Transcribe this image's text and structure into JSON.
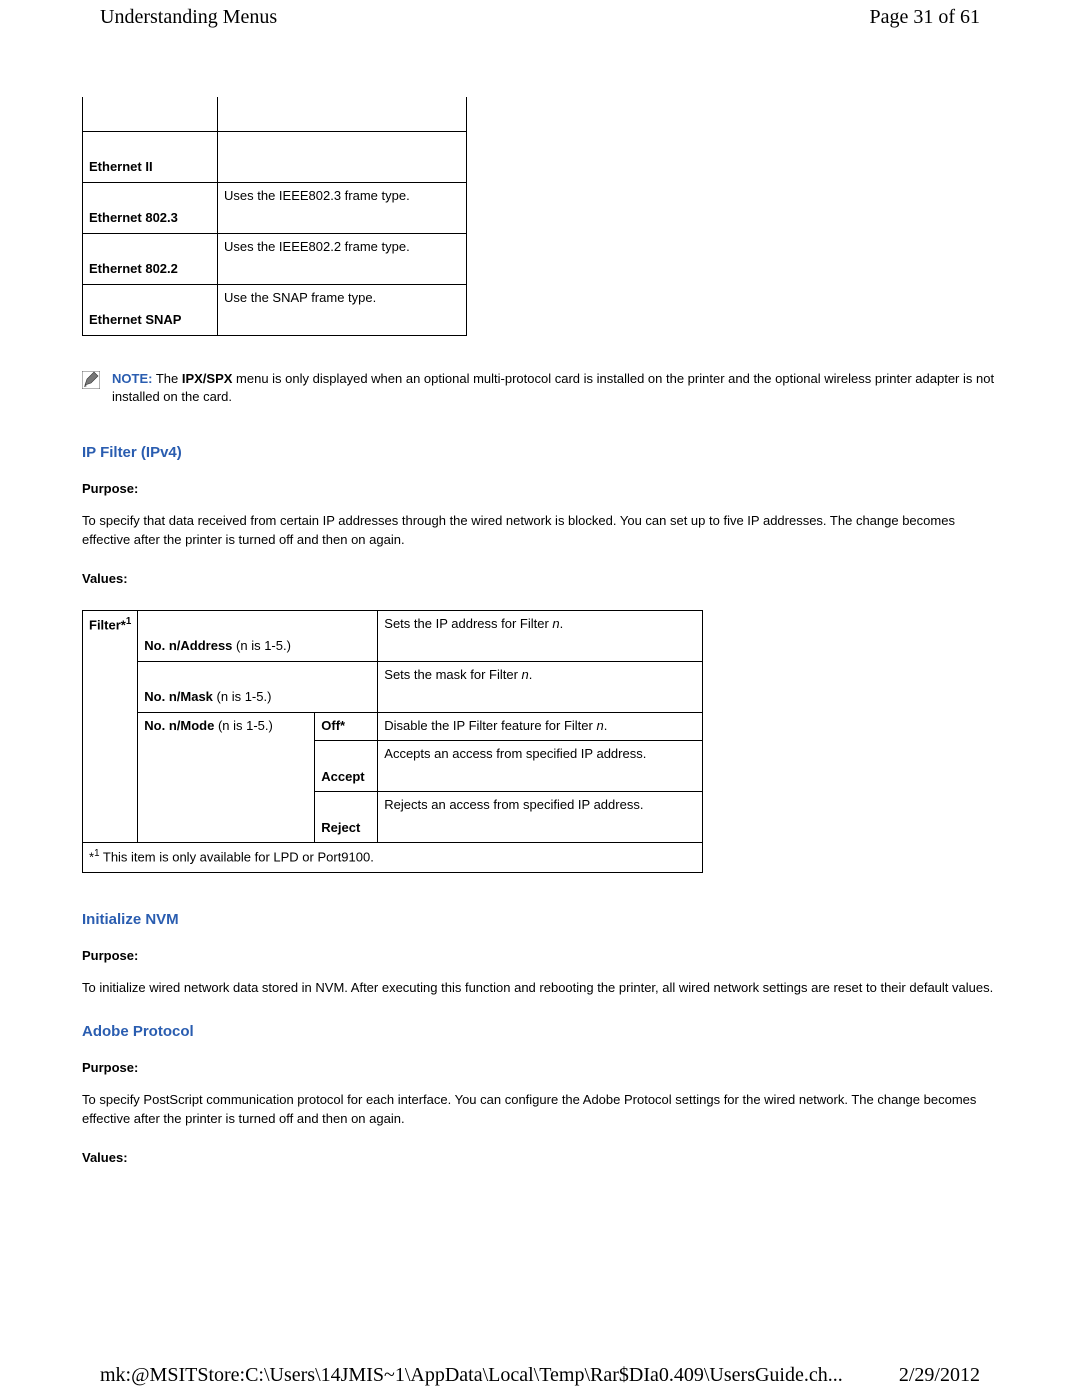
{
  "header": {
    "title": "Understanding Menus",
    "page_label": "Page 31 of 61"
  },
  "frame_table": {
    "rows": [
      {
        "label": "Ethernet II",
        "desc": ""
      },
      {
        "label": "Ethernet 802.3",
        "desc": "Uses the IEEE802.3 frame type."
      },
      {
        "label": "Ethernet 802.2",
        "desc": "Uses the IEEE802.2 frame type."
      },
      {
        "label": "Ethernet SNAP",
        "desc": "Use the SNAP frame type."
      }
    ]
  },
  "note": {
    "label": "NOTE:",
    "text_before_bold": " The ",
    "bold_term": "IPX/SPX",
    "text_after_bold": " menu is only displayed when an optional multi-protocol card is installed on the printer and the optional wireless printer adapter is not installed on the card."
  },
  "ip_filter": {
    "heading": "IP Filter (IPv4)",
    "purpose_label": "Purpose:",
    "purpose_text": "To specify that data received from certain IP addresses through the wired network is blocked. You can set up to five IP addresses. The change becomes effective after the printer is turned off and then on again.",
    "values_label": "Values:",
    "table": {
      "filter_label": "Filter*",
      "filter_sup": "1",
      "row1_bold": "No. n/Address",
      "row1_paren": " (n is 1-5.)",
      "row1_desc_pre": "Sets the IP address for Filter ",
      "row1_desc_var": "n",
      "row1_desc_post": ".",
      "row2_bold": "No. n/Mask",
      "row2_paren": " (n is 1-5.)",
      "row2_desc_pre": "Sets the mask for Filter ",
      "row2_desc_var": "n",
      "row2_desc_post": ".",
      "row3_bold": "No. n/Mode",
      "row3_paren": " (n is 1-5.)",
      "mode_off": "Off*",
      "mode_off_desc_pre": "Disable the IP Filter feature for Filter ",
      "mode_off_desc_var": "n",
      "mode_off_desc_post": ".",
      "mode_accept": "Accept",
      "mode_accept_desc": "Accepts an access from specified IP address.",
      "mode_reject": "Reject",
      "mode_reject_desc": "Rejects an access from specified IP address.",
      "footnote_sup": "1",
      "footnote_prefix": "*",
      "footnote_text": " This item is only available for LPD or Port9100."
    }
  },
  "initialize_nvm": {
    "heading": "Initialize NVM",
    "purpose_label": "Purpose:",
    "purpose_text": "To initialize wired network data stored in NVM. After executing this function and rebooting the printer, all wired network settings are reset to their default values."
  },
  "adobe_protocol": {
    "heading": "Adobe Protocol",
    "purpose_label": "Purpose:",
    "purpose_text": "To specify PostScript communication protocol for each interface. You can configure the Adobe Protocol settings for the wired network. The change becomes effective after the printer is turned off and then on again.",
    "values_label": "Values:"
  },
  "footer": {
    "path": "mk:@MSITStore:C:\\Users\\14JMIS~1\\AppData\\Local\\Temp\\Rar$DIa0.409\\UsersGuide.ch...",
    "date": "2/29/2012"
  }
}
